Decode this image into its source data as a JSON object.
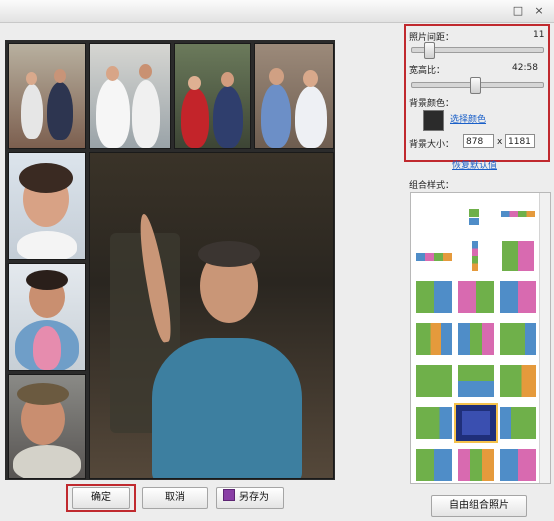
{
  "window": {
    "restore_glyph": "□",
    "close_glyph": "×"
  },
  "settings": {
    "spacing_label": "照片间距：",
    "spacing_value": "11",
    "spacing_level": 0.1,
    "ratio_label": "宽高比：",
    "ratio_value": "42:58",
    "ratio_level": 0.48,
    "bg_color_label": "背景颜色：",
    "bg_color_value": "#2b2b2b",
    "choose_color_link": "选择颜色",
    "bg_size_label": "背景大小：",
    "width_value": "878",
    "size_separator": "x",
    "height_value": "1181",
    "restore_defaults_link": "恢复默认值"
  },
  "styles_panel": {
    "label": "组合样式："
  },
  "buttons": {
    "ok": "确定",
    "cancel": "取消",
    "save_as": "另存为",
    "free_combine": "自由组合照片"
  },
  "accent": {
    "highlight": "#c0292e",
    "link": "#1a5fc8",
    "selected_tile": "#1f2f7a"
  }
}
